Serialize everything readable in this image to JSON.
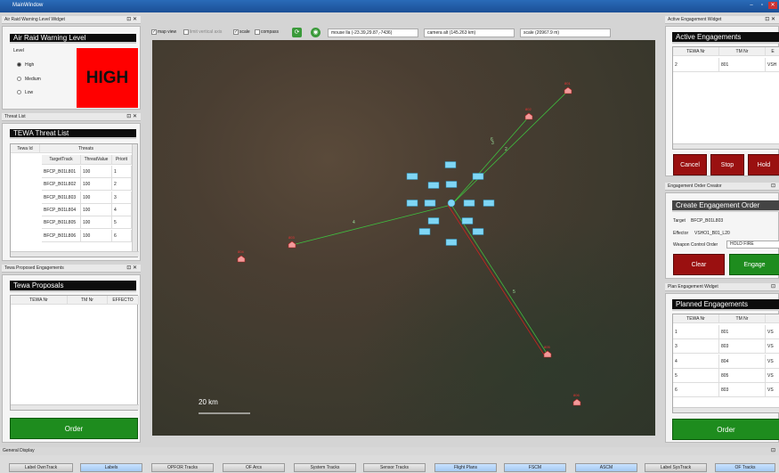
{
  "window": {
    "title": "MainWindow",
    "min": "–",
    "max": "▫",
    "close": "✕"
  },
  "air_raid": {
    "dock_title": "Air Raid Warning Level Widget",
    "header": "Air Raid Warning Level",
    "level_label": "Level",
    "options": [
      "High",
      "Medium",
      "Low"
    ],
    "selected": "High",
    "indicator": "HIGH",
    "indicator_color": "#ff0000"
  },
  "threat_list": {
    "dock_title": "Threat List",
    "header": "TEWA Threat List",
    "col_tewa": "Tewa Id",
    "col_threats": "Threats",
    "sub_cols": [
      "TargetTrack",
      "ThreatValue",
      "Priorit"
    ],
    "rows": [
      [
        "BFCP_B01L801",
        "100",
        "1"
      ],
      [
        "BFCP_B01L802",
        "100",
        "2"
      ],
      [
        "BFCP_B01L803",
        "100",
        "3"
      ],
      [
        "BFCP_B01L804",
        "100",
        "4"
      ],
      [
        "BFCP_B01L805",
        "100",
        "5"
      ],
      [
        "BFCP_B01L806",
        "100",
        "6"
      ]
    ]
  },
  "proposed": {
    "dock_title": "Tewa Proposed Engagements",
    "header": "Tewa Proposals",
    "cols": [
      "TEWA Nr",
      "TM Nr",
      "EFFECTO"
    ],
    "order": "Order"
  },
  "toolbar": {
    "map_view": "map view",
    "limit_vertical": "limit vertical axis",
    "scale": "scale",
    "compass": "compass",
    "mouse": "mouse lla (-23.39,29.87,-7436)",
    "camera": "camera alt (145.263 km)",
    "scale_value": "scale (20967.9 m)"
  },
  "map": {
    "scale_text": "20 km",
    "track_labels": [
      "801",
      "802",
      "803",
      "804",
      "805",
      "806"
    ],
    "line_labels": [
      "2",
      "3",
      "4",
      "5",
      "6"
    ]
  },
  "active": {
    "dock_title": "Active Engagement Widget",
    "header": "Active Engagements",
    "cols": [
      "TEWA Nr",
      "TM Nr",
      "E"
    ],
    "rows": [
      [
        "2",
        "801",
        "VSH"
      ]
    ],
    "cancel": "Cancel",
    "stop": "Stop",
    "hold": "Hold"
  },
  "creator": {
    "dock_title": "Engagement Order Creator",
    "header": "Create Engagement Order",
    "target_label": "Target",
    "target": "BFCP_B01L803",
    "effector_label": "Effector",
    "effector": "VSHO1_B01_L20",
    "wco_label": "Weapon Control Order",
    "wco": "HOLD FIRE",
    "clear": "Clear",
    "engage": "Engage"
  },
  "planned": {
    "dock_title": "Plan Engagement Widget",
    "header": "Planned Engagements",
    "cols": [
      "TEWA Nr",
      "TM Nr",
      ""
    ],
    "rows": [
      [
        "1",
        "801",
        "VS"
      ],
      [
        "3",
        "803",
        "VS"
      ],
      [
        "4",
        "804",
        "VS"
      ],
      [
        "5",
        "805",
        "VS"
      ],
      [
        "6",
        "803",
        "VS"
      ]
    ],
    "order": "Order"
  },
  "general": {
    "dock_title": "General Display",
    "buttons": [
      "Label OwnTrack",
      "Labels",
      "OPFOR Tracks",
      "OF Arcs",
      "System Tracks",
      "Sensor Tracks",
      "Flight Plans",
      "FSCM",
      "ASCM",
      "Label SysTrack",
      "OF Tracks"
    ],
    "selected": [
      "Labels",
      "Flight Plans",
      "FSCM",
      "ASCM",
      "OF Tracks"
    ]
  },
  "colors": {
    "green": "#1e8c1e",
    "red": "#9a1010",
    "high": "#ff0000",
    "friendly": "#7fd6f5"
  }
}
